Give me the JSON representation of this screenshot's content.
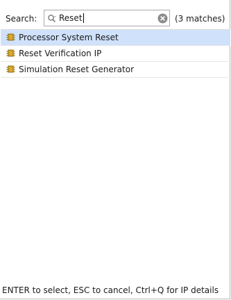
{
  "search": {
    "label": "Search:",
    "value": "Reset",
    "match_count": "(3 matches)"
  },
  "results": [
    {
      "label": "Processor System Reset",
      "selected": true,
      "icon": "ip-core-icon"
    },
    {
      "label": "Reset Verification IP",
      "selected": false,
      "icon": "ip-core-icon"
    },
    {
      "label": "Simulation Reset Generator",
      "selected": false,
      "icon": "ip-core-icon"
    }
  ],
  "footer": {
    "hint": "ENTER to select, ESC to cancel, Ctrl+Q for IP details"
  },
  "colors": {
    "selection": "#cfe1fb",
    "icon_body": "#d9a92b",
    "icon_pins": "#8a6a12"
  }
}
